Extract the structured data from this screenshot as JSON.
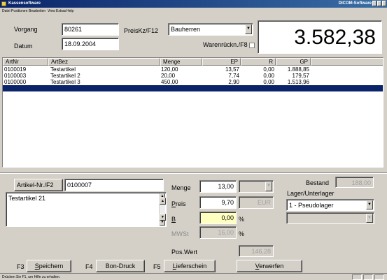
{
  "window": {
    "title": "Kassensoftware",
    "vendor": "DICOM-Software"
  },
  "menu": [
    "Datei",
    "Positionen",
    "Bearbeiten",
    "View",
    "Extras",
    "Help"
  ],
  "header": {
    "vorgang_label": "Vorgang",
    "vorgang_value": "80261",
    "datum_label": "Datum",
    "datum_value": "18.09.2004",
    "preiskz_label": "PreisKz/F12",
    "preiskz_value": "Bauherren",
    "warenrueck_label": "Warenrückn./F8",
    "total": "3.582,38"
  },
  "table": {
    "columns": [
      "ArtNr",
      "ArtBez",
      "Menge",
      "EP",
      "R",
      "GP"
    ],
    "rows": [
      [
        "0100019",
        "Testartikel",
        "120,00",
        "13,57",
        "0,00",
        "1.888,85"
      ],
      [
        "0100003",
        "Testartikel 2",
        "20,00",
        "7,74",
        "0,00",
        "179,57"
      ],
      [
        "0100000",
        "Testartikel 3",
        "450,00",
        "2,90",
        "0,00",
        "1.513,96"
      ]
    ]
  },
  "article": {
    "artikel_button": "Artikel-Nr./F2",
    "artikel_value": "0100007",
    "description": "Testartikel 21",
    "menge_label": "Menge",
    "menge_value": "13,00",
    "preis_label": "Preis",
    "preis_value": "9,70",
    "currency": "EUR",
    "b_label": "B",
    "b_value": "0,00",
    "percent": "%",
    "mwst_label": "MWSt",
    "mwst_value": "16,00",
    "poswert_label": "Pos.Wert",
    "poswert_value": "146,28",
    "bestand_label": "Bestand",
    "bestand_value": "188,00",
    "lager_label": "Lager/Unterlager",
    "lager_value": "1 - Pseudolager"
  },
  "footer": {
    "f3": "F3",
    "speichern": "Speichern",
    "f4": "F4",
    "bon_druck": "Bon-Druck",
    "f5": "F5",
    "lieferschein": "Lieferschein",
    "verwerfen": "Verwerfen"
  },
  "status": {
    "hint": "Drücken Sie F1, um Hilfe zu erhalten."
  }
}
